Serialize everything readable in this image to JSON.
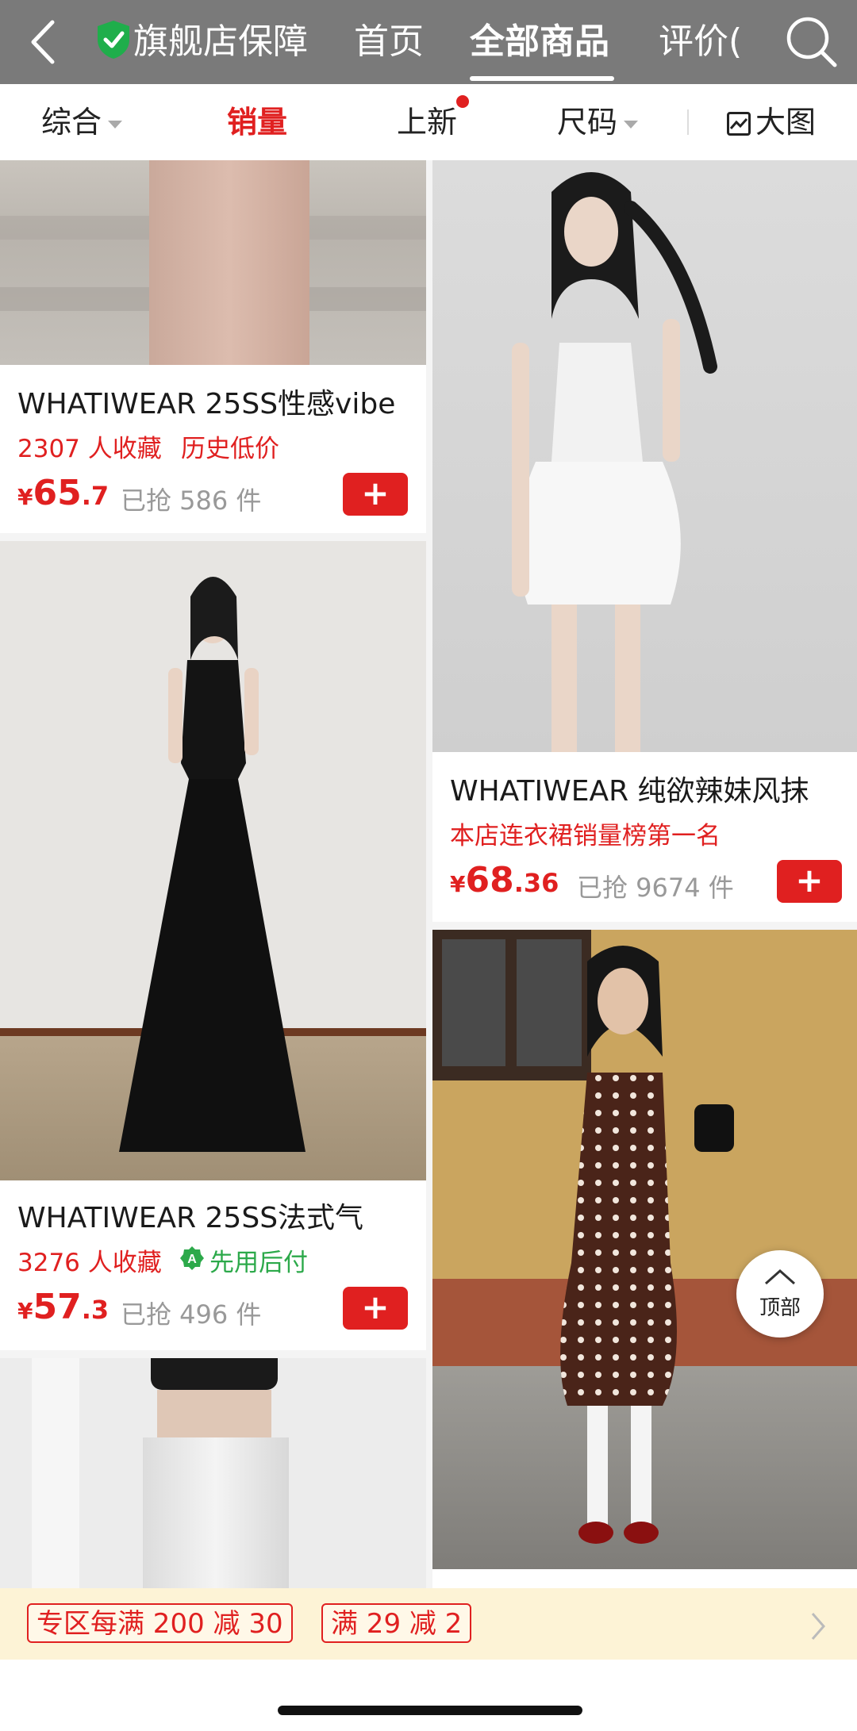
{
  "header": {
    "guarantee_label": "旗舰店保障",
    "tabs": [
      {
        "label": "首页"
      },
      {
        "label": "全部商品"
      },
      {
        "label": "评价("
      }
    ]
  },
  "filters": {
    "comprehensive": "综合",
    "sales": "销量",
    "new": "上新",
    "size": "尺码",
    "big_image": "大图"
  },
  "products": [
    {
      "title": "WHATIWEAR 25SS性感vibe",
      "tags": [
        "2307 人收藏",
        "历史低价"
      ],
      "currency": "¥",
      "price_int": "65",
      "price_dec": ".7",
      "sold": "已抢 586 件"
    },
    {
      "title": "WHATIWEAR 纯欲辣妹风抹",
      "tags": [
        "本店连衣裙销量榜第一名"
      ],
      "currency": "¥",
      "price_int": "68",
      "price_dec": ".36",
      "sold": "已抢 9674 件"
    },
    {
      "title": "WHATIWEAR 25SS法式气",
      "tags": [
        "3276 人收藏",
        "先用后付"
      ],
      "currency": "¥",
      "price_int": "57",
      "price_dec": ".3",
      "sold": "已抢 496 件"
    }
  ],
  "add_symbol": "+",
  "back_to_top": "顶部",
  "promo": {
    "tags": [
      "专区每满 200 减 30",
      "满 29 减 2"
    ]
  },
  "colors": {
    "accent_red": "#e02020",
    "header_gray": "#7a7a7a",
    "promo_bg": "#fdf3d6",
    "green": "#2ca94a"
  }
}
